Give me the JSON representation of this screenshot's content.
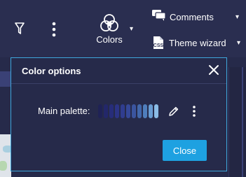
{
  "toolbar": {
    "filter_icon": "filter-icon",
    "more_icon": "kebab-icon",
    "colors": {
      "label": "Colors",
      "icon": "color-circles-icon",
      "caret": "▾"
    },
    "comments": {
      "label": "Comments",
      "icon": "comment-icon",
      "caret": "▾"
    },
    "theme_wizard": {
      "label": "Theme wizard",
      "icon": "css-icon",
      "icon_text": "CSS",
      "caret": "▾"
    }
  },
  "dialog": {
    "title": "Color options",
    "close_icon": "close-icon",
    "palette": {
      "label": "Main palette:",
      "swatch_colors": [
        "#1f2256",
        "#23276a",
        "#272d7a",
        "#2c3486",
        "#303d8f",
        "#354898",
        "#3b559f",
        "#4267aa",
        "#4f7ebc",
        "#6a9dd2",
        "#8bbce6"
      ],
      "edit_icon": "pencil-icon",
      "more_icon": "kebab-icon"
    },
    "close_button": "Close"
  },
  "colors": {
    "background": "#262a4a",
    "accent": "#1ea1e1",
    "border": "#3fa7dc"
  }
}
